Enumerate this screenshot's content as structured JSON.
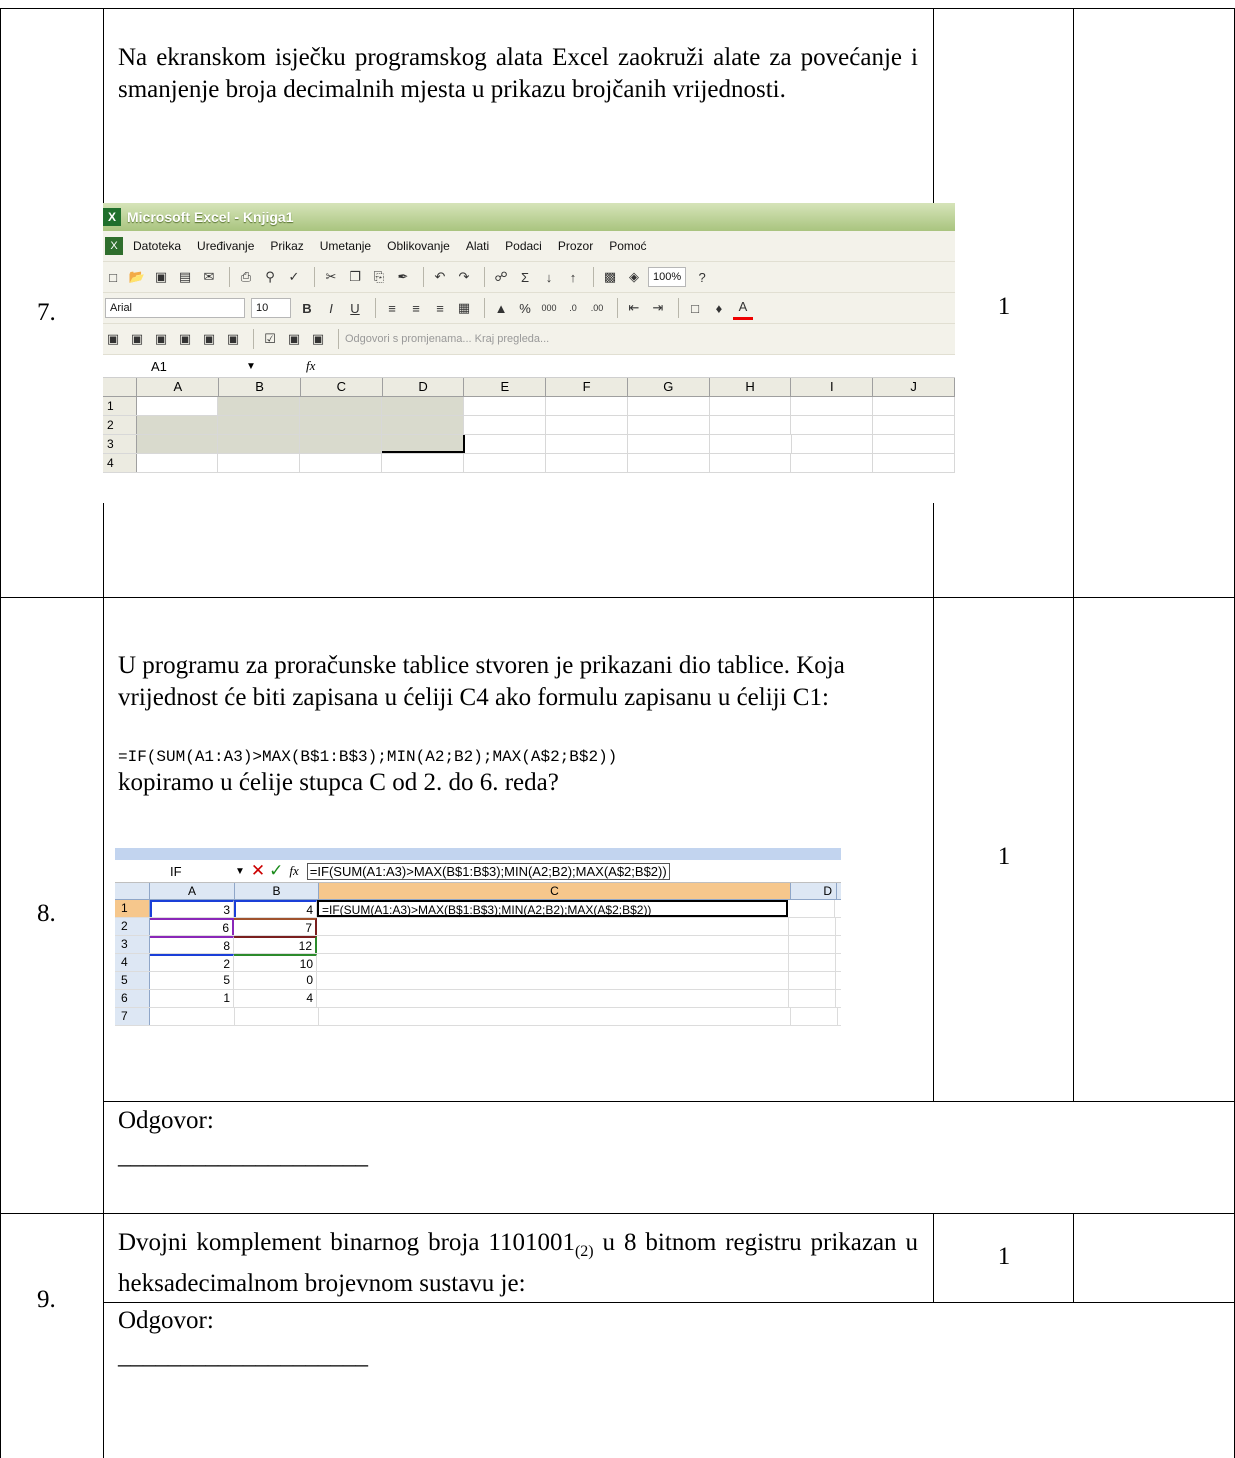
{
  "q7": {
    "number": "7.",
    "text": "Na ekranskom isječku programskog alata Excel zaokruži alate za povećanje i smanjenje broja decimalnih mjesta u prikazu brojčanih vrijednosti.",
    "points": "1",
    "excel": {
      "title": "Microsoft Excel - Knjiga1",
      "menu": [
        "Datoteka",
        "Uređivanje",
        "Prikaz",
        "Umetanje",
        "Oblikovanje",
        "Alati",
        "Podaci",
        "Prozor",
        "Pomoć"
      ],
      "zoom": "100%",
      "font": "Arial",
      "font_size": "10",
      "percent": "%",
      "thousands": "000",
      "review_text": "Odgovori s promjenama... Kraj pregleda...",
      "namebox": "A1",
      "fx": "fx",
      "columns": [
        "A",
        "B",
        "C",
        "D",
        "E",
        "F",
        "G",
        "H",
        "I",
        "J"
      ],
      "rows": [
        "1",
        "2",
        "3",
        "4"
      ]
    }
  },
  "q8": {
    "number": "8.",
    "text": "U programu za proračunske tablice stvoren je prikazani dio tablice. Koja vrijednost će biti zapisana u ćeliji C4 ako formulu zapisanu u ćeliji C1:",
    "formula": "=IF(SUM(A1:A3)>MAX(B$1:B$3);MIN(A2;B2);MAX(A$2;B$2))",
    "text2": "kopiramo u ćelije stupca C od 2. do 6. reda?",
    "points": "1",
    "sheet": {
      "namebox": "IF",
      "fx": "fx",
      "formula": "=IF(SUM(A1:A3)>MAX(B$1:B$3);MIN(A2;B2);MAX(A$2;B$2))",
      "columns": [
        "A",
        "B",
        "C",
        "D"
      ],
      "rows": [
        {
          "r": "1",
          "a": "3",
          "b": "4"
        },
        {
          "r": "2",
          "a": "6",
          "b": "7"
        },
        {
          "r": "3",
          "a": "8",
          "b": "12"
        },
        {
          "r": "4",
          "a": "2",
          "b": "10"
        },
        {
          "r": "5",
          "a": "5",
          "b": "0"
        },
        {
          "r": "6",
          "a": "1",
          "b": "4"
        },
        {
          "r": "7",
          "a": "",
          "b": ""
        }
      ]
    },
    "answer_label": "Odgovor:",
    "answer_line": "____________________"
  },
  "q9": {
    "number": "9.",
    "text_before": "Dvojni komplement binarnog broja 1101001",
    "subscript": "(2)",
    "text_after": " u 8 bitnom registru prikazan u heksadecimalnom brojevnom sustavu je:",
    "points": "1",
    "answer_label": "Odgovor:",
    "answer_line": "____________________"
  }
}
